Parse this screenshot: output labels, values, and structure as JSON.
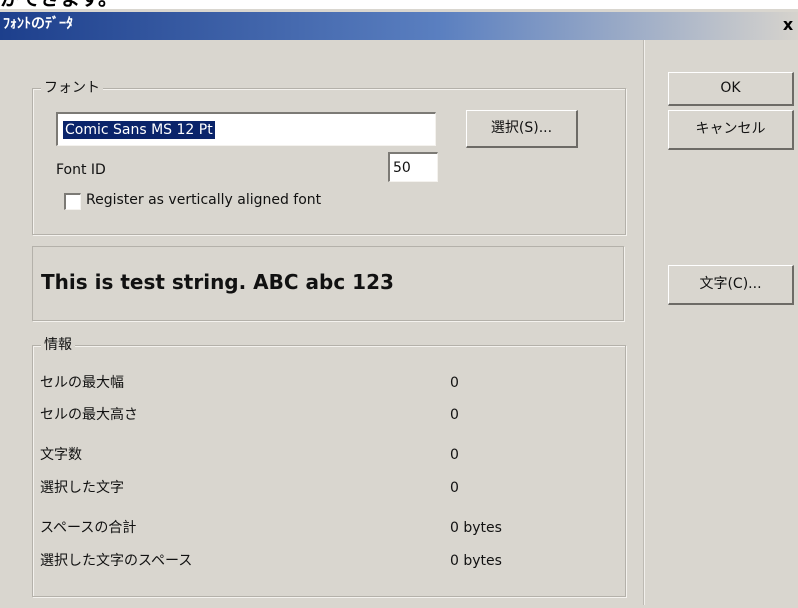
{
  "top_text": "かできます。",
  "window": {
    "title": "ﾌｫﾝﾄのﾃﾞｰﾀ",
    "close_label": "x"
  },
  "font_group": {
    "label": "フォント",
    "font_name_value": "Comic Sans MS 12 Pt",
    "select_button_label": "選択(S)...",
    "font_id_label": "Font ID",
    "font_id_value": "50",
    "vertical_checkbox_label": "Register as vertically aligned font",
    "vertical_checked": false
  },
  "preview": {
    "text": "This is test string. ABC abc 123"
  },
  "info_group": {
    "label": "情報",
    "rows": [
      {
        "label": "セルの最大幅",
        "value": "0"
      },
      {
        "label": "セルの最大高さ",
        "value": "0"
      },
      {
        "label": "文字数",
        "value": "0"
      },
      {
        "label": "選択した文字",
        "value": "0"
      },
      {
        "label": "スペースの合計",
        "value": "0 bytes"
      },
      {
        "label": "選択した文字のスペース",
        "value": "0 bytes"
      }
    ]
  },
  "buttons": {
    "ok": "OK",
    "cancel": "キャンセル",
    "characters": "文字(C)..."
  },
  "colors": {
    "title_gradient_start": "#1d3f8c",
    "title_gradient_end": "#d6d3cd",
    "dialog_face": "#d9d6cf",
    "selection": "#0a246a"
  }
}
